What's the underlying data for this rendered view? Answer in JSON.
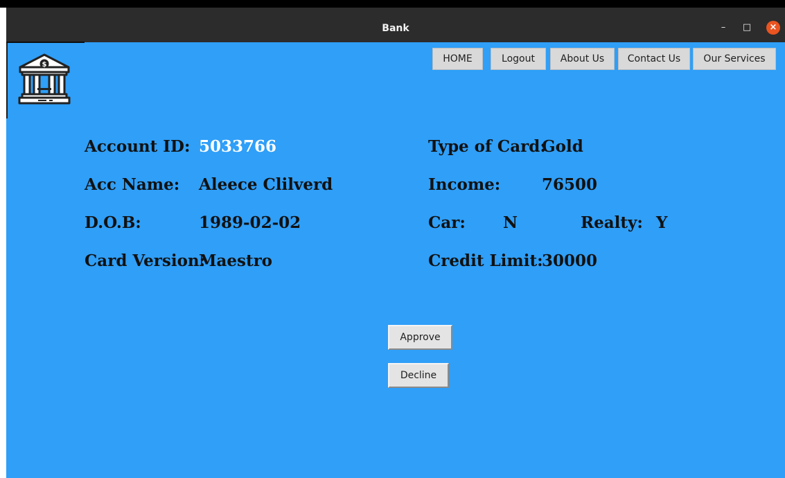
{
  "window": {
    "title": "Bank",
    "controls": {
      "minimize": "–",
      "maximize": "□",
      "close": "×"
    }
  },
  "nav": {
    "home": "HOME",
    "logout": "Logout",
    "about": "About Us",
    "contact": "Contact Us",
    "services": "Our Services"
  },
  "logo": {
    "icon": "bank-building-icon",
    "symbol": "$"
  },
  "details": {
    "account_id_label": "Account ID:",
    "account_id_value": "5033766",
    "acc_name_label": "Acc Name:",
    "acc_name_value": "Aleece Clilverd",
    "dob_label": "D.O.B:",
    "dob_value": "1989-02-02",
    "card_version_label": "Card Version:",
    "card_version_value": "Maestro",
    "card_type_label": "Type of Card:",
    "card_type_value": "Gold",
    "income_label": "Income:",
    "income_value": "76500",
    "car_label": "Car:",
    "car_value": "N",
    "realty_label": "Realty:",
    "realty_value": "Y",
    "credit_limit_label": "Credit Limit:",
    "credit_limit_value": "30000"
  },
  "actions": {
    "approve": "Approve",
    "decline": "Decline"
  },
  "colors": {
    "background": "#2f9ff8",
    "titlebar": "#2c2c2c",
    "close_button": "#e95420",
    "account_id_value": "#ffffff"
  }
}
